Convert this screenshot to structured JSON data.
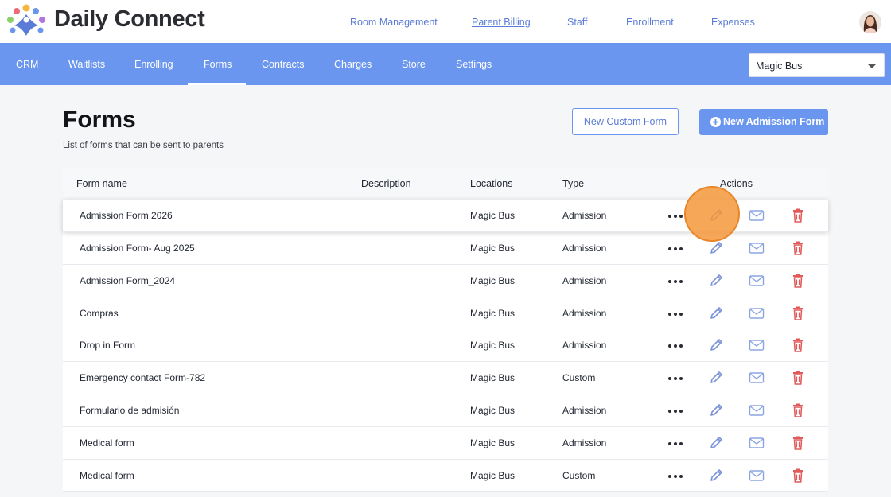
{
  "app": {
    "brand": "Daily Connect"
  },
  "top_nav": [
    {
      "label": "Room Management",
      "active": false
    },
    {
      "label": "Parent Billing",
      "active": true
    },
    {
      "label": "Staff",
      "active": false
    },
    {
      "label": "Enrollment",
      "active": false
    },
    {
      "label": "Expenses",
      "active": false
    }
  ],
  "sub_nav": [
    {
      "label": "CRM"
    },
    {
      "label": "Waitlists"
    },
    {
      "label": "Enrolling"
    },
    {
      "label": "Forms",
      "active": true
    },
    {
      "label": "Contracts"
    },
    {
      "label": "Charges"
    },
    {
      "label": "Store"
    },
    {
      "label": "Settings"
    }
  ],
  "location_select": {
    "value": "Magic Bus"
  },
  "page": {
    "title": "Forms",
    "subtitle": "List of forms that can be sent to parents",
    "new_custom_label": "New Custom Form",
    "new_admission_label": "New Admission Form"
  },
  "table": {
    "columns": [
      "Form name",
      "Description",
      "Locations",
      "Type",
      "Actions"
    ],
    "rows": [
      {
        "name": "Admission Form 2026",
        "description": "",
        "location": "Magic Bus",
        "type": "Admission"
      },
      {
        "name": "Admission Form- Aug 2025",
        "description": "",
        "location": "Magic Bus",
        "type": "Admission"
      },
      {
        "name": "Admission Form_2024",
        "description": "",
        "location": "Magic Bus",
        "type": "Admission"
      },
      {
        "name": "Compras",
        "description": "",
        "location": "Magic Bus",
        "type": "Admission"
      },
      {
        "name": "Drop in Form",
        "description": "",
        "location": "Magic Bus",
        "type": "Admission"
      },
      {
        "name": "Emergency contact Form-782",
        "description": "",
        "location": "Magic Bus",
        "type": "Custom"
      },
      {
        "name": "Formulario de admisión",
        "description": "",
        "location": "Magic Bus",
        "type": "Admission"
      },
      {
        "name": "Medical form",
        "description": "",
        "location": "Magic Bus",
        "type": "Admission"
      },
      {
        "name": "Medical form",
        "description": "",
        "location": "Magic Bus",
        "type": "Custom"
      }
    ]
  },
  "colors": {
    "accent": "#6b96ef",
    "link": "#5b7cd6",
    "delete": "#e25b5b",
    "cursor_marker": "#f4983a"
  },
  "icons": {
    "row_actions": [
      "more-dots-icon",
      "pencil-edit-icon",
      "envelope-icon",
      "trash-icon"
    ],
    "button": "plus-circle-icon"
  }
}
